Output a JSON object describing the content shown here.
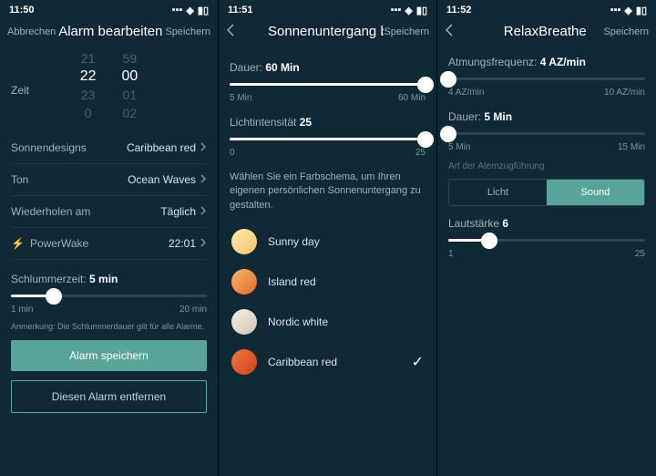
{
  "s1": {
    "time": "11:50",
    "loc_icon": "↗",
    "cancel": "Abbrechen",
    "title": "Alarm bearbeiten",
    "save": "Speichern",
    "time_label": "Zeit",
    "picker_h": [
      "21",
      "22",
      "23",
      "0"
    ],
    "picker_m": [
      "59",
      "00",
      "01",
      "02"
    ],
    "rows": {
      "design": {
        "lbl": "Sonnendesigns",
        "val": "Caribbean red"
      },
      "ton": {
        "lbl": "Ton",
        "val": "Ocean Waves"
      },
      "repeat": {
        "lbl": "Wiederholen am",
        "val": "Täglich"
      },
      "pw": {
        "lbl": "PowerWake",
        "val": "22:01"
      }
    },
    "snooze": {
      "lbl": "Schlummerzeit:",
      "val": "5 min",
      "min": "1 min",
      "max": "20 min",
      "pct": 22
    },
    "note": "Anmerkung: Die Schlummerdauer gilt für alle Alarme.",
    "btn_save": "Alarm speichern",
    "btn_delete": "Diesen Alarm entfernen"
  },
  "s2": {
    "time": "11:51",
    "loc_icon": "↗",
    "title": "Sonnenuntergang bearbe",
    "save": "Speichern",
    "dur": {
      "lbl": "Dauer:",
      "val": "60 Min",
      "min": "5 Min",
      "max": "60 Min",
      "pct": 100
    },
    "licht": {
      "lbl": "Lichtintensität",
      "val": "25",
      "min": "0",
      "max": "25",
      "pct": 100
    },
    "help": "Wählen Sie ein Farbschema, um Ihren eigenen persönlichen Sonnenuntergang zu gestalten.",
    "colors": [
      {
        "name": "Sunny day",
        "grad": "linear-gradient(135deg,#ffe9a8,#f6c76b)",
        "sel": false
      },
      {
        "name": "Island red",
        "grad": "linear-gradient(135deg,#f7b96a,#e06a2a)",
        "sel": false
      },
      {
        "name": "Nordic white",
        "grad": "linear-gradient(135deg,#f5efe2,#cfc7b5)",
        "sel": false
      },
      {
        "name": "Caribbean red",
        "grad": "linear-gradient(135deg,#f07a3a,#d23f20)",
        "sel": true
      }
    ]
  },
  "s3": {
    "time": "11:52",
    "loc_icon": "↗",
    "title": "RelaxBreathe",
    "save": "Speichern",
    "freq": {
      "lbl": "Atmungsfrequenz:",
      "val": "4 AZ/min",
      "min": "4 AZ/min",
      "max": "10 AZ/min",
      "pct": 0
    },
    "dur": {
      "lbl": "Dauer:",
      "val": "5 Min",
      "min": "5 Min",
      "max": "15 Min",
      "pct": 0
    },
    "guide_label": "Art der Atemzugführung",
    "seg_left": "Licht",
    "seg_right": "Sound",
    "vol": {
      "lbl": "Lautstärke",
      "val": "6",
      "min": "1",
      "max": "25",
      "pct": 21
    }
  }
}
